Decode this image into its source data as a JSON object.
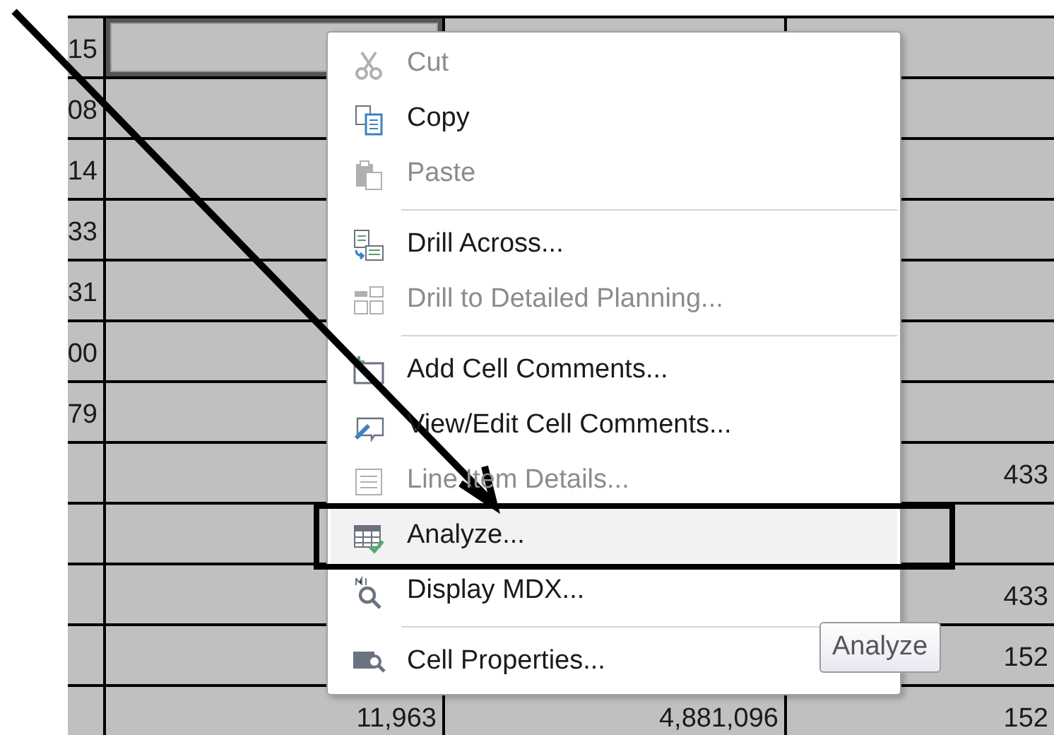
{
  "grid": {
    "rows": [
      {
        "column_1": "15",
        "selected": true
      },
      {
        "column_1": "08",
        "selected": false
      },
      {
        "column_1": "14",
        "selected": false
      },
      {
        "column_1": "33",
        "selected": false
      },
      {
        "column_1": "31",
        "selected": false
      },
      {
        "column_1": "00",
        "selected": false
      },
      {
        "column_1": "79",
        "selected": false
      },
      {
        "column_4": "433",
        "selected": false
      },
      {
        "selected": false
      },
      {
        "column_4": "433",
        "selected": false
      },
      {
        "column_4": "152",
        "selected": false
      },
      {
        "column_2": "11,963",
        "column_3": "4,881,096",
        "column_4": "152",
        "selected": false
      }
    ]
  },
  "context_menu": {
    "items": [
      {
        "kind": "item",
        "label": "Cut",
        "disabled": true,
        "selected": false
      },
      {
        "kind": "item",
        "label": "Copy",
        "disabled": false,
        "selected": false
      },
      {
        "kind": "item",
        "label": "Paste",
        "disabled": true,
        "selected": false
      },
      {
        "kind": "separator"
      },
      {
        "kind": "item",
        "label": "Drill Across...",
        "disabled": false,
        "selected": false
      },
      {
        "kind": "item",
        "label": "Drill to Detailed Planning...",
        "disabled": true,
        "selected": false
      },
      {
        "kind": "separator"
      },
      {
        "kind": "item",
        "label": "Add Cell Comments...",
        "disabled": false,
        "selected": false
      },
      {
        "kind": "item",
        "label": "View/Edit Cell Comments...",
        "disabled": false,
        "selected": false
      },
      {
        "kind": "item",
        "label": "Line Item Details...",
        "disabled": true,
        "selected": false
      },
      {
        "kind": "item",
        "label": "Analyze...",
        "disabled": false,
        "selected": true
      },
      {
        "kind": "item",
        "label": "Display MDX...",
        "disabled": false,
        "selected": false
      },
      {
        "kind": "separator"
      },
      {
        "kind": "item",
        "label": "Cell Properties...",
        "disabled": false,
        "selected": false
      }
    ]
  },
  "tooltip": {
    "text": "Analyze"
  }
}
